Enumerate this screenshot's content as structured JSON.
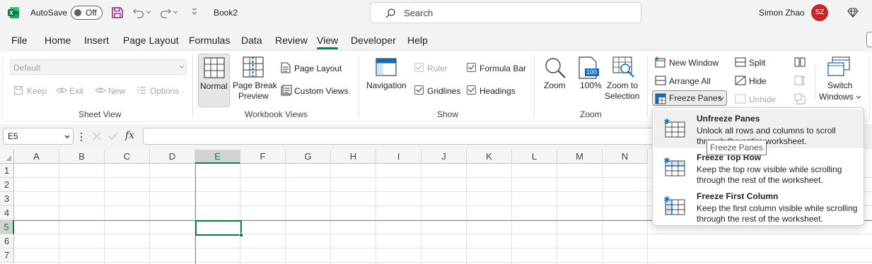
{
  "titlebar": {
    "autosave_label": "AutoSave",
    "autosave_state": "Off",
    "filename": "Book2",
    "search_placeholder": "Search",
    "user_name": "Simon Zhao",
    "user_initials": "SZ"
  },
  "menu": {
    "tabs": [
      "File",
      "Home",
      "Insert",
      "Page Layout",
      "Formulas",
      "Data",
      "Review",
      "View",
      "Developer",
      "Help"
    ],
    "active": "View"
  },
  "ribbon": {
    "sheet_view": {
      "select_value": "Default",
      "keep": "Keep",
      "exit": "Exit",
      "new": "New",
      "options": "Options",
      "label": "Sheet View"
    },
    "workbook_views": {
      "normal": "Normal",
      "page_break_1": "Page Break",
      "page_break_2": "Preview",
      "page_layout": "Page Layout",
      "custom_views": "Custom Views",
      "label": "Workbook Views"
    },
    "show": {
      "navigation": "Navigation",
      "ruler": "Ruler",
      "formula_bar": "Formula Bar",
      "gridlines": "Gridlines",
      "headings": "Headings",
      "label": "Show"
    },
    "zoom": {
      "zoom": "Zoom",
      "hundred": "100%",
      "hundred_icon_text": "100",
      "zoom_sel_1": "Zoom to",
      "zoom_sel_2": "Selection",
      "label": "Zoom"
    },
    "window": {
      "new_window": "New Window",
      "arrange_all": "Arrange All",
      "freeze_panes": "Freeze Panes",
      "split": "Split",
      "hide": "Hide",
      "unhide": "Unhide",
      "switch_1": "Switch",
      "switch_2": "Windows"
    }
  },
  "formula_bar": {
    "name_box": "E5",
    "fx": "fx",
    "value": ""
  },
  "grid": {
    "columns": [
      "A",
      "B",
      "C",
      "D",
      "E",
      "F",
      "G",
      "H",
      "I",
      "J",
      "K",
      "L",
      "M",
      "N"
    ],
    "rows": [
      "1",
      "2",
      "3",
      "4",
      "5",
      "6",
      "7"
    ],
    "selected_cell": "E5"
  },
  "freeze_menu": {
    "items": [
      {
        "title": "Unfreeze Panes",
        "desc": "Unlock all rows and columns to scroll through the entire worksheet."
      },
      {
        "title": "Freeze Top Row",
        "desc": "Keep the top row visible while scrolling through the rest of the worksheet."
      },
      {
        "title": "Freeze First Column",
        "desc": "Keep the first column visible while scrolling through the rest of the worksheet."
      }
    ],
    "tooltip": "Freeze Panes"
  },
  "colors": {
    "accent": "#107c41",
    "avatar": "#c4262e",
    "save_icon": "#9b2c8f"
  }
}
